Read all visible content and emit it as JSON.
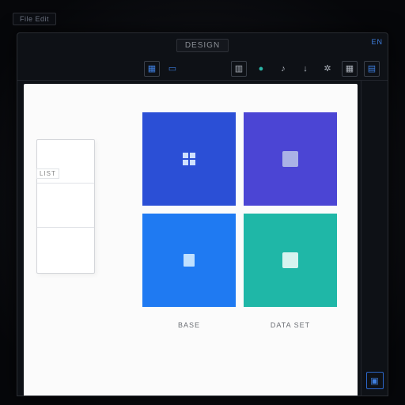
{
  "menuHint": "File Edit",
  "title": "DESIGN",
  "cornerTag": "EN",
  "toolbar": {
    "layers": "layers",
    "outline": "outline",
    "chat": "chat",
    "music": "music",
    "download": "download",
    "settings": "settings",
    "grid": "grid",
    "library": "library"
  },
  "secondary": {
    "swap": "swap",
    "align": "align"
  },
  "leftPanel": {
    "label": "LIST",
    "slot1": "",
    "slot2": "",
    "slot3": ""
  },
  "tiles": {
    "t1": {
      "name": "dashboard-tile",
      "color": "#2b4fd6"
    },
    "t2": {
      "name": "component-tile",
      "color": "#4b45d4"
    },
    "t3": {
      "name": "document-tile",
      "color": "#1f7af2"
    },
    "t4": {
      "name": "theme-tile",
      "color": "#1fb7a7"
    }
  },
  "captions": {
    "left": "BASE",
    "right": "DATA SET"
  },
  "rightRail": {
    "collapse": "collapse"
  }
}
